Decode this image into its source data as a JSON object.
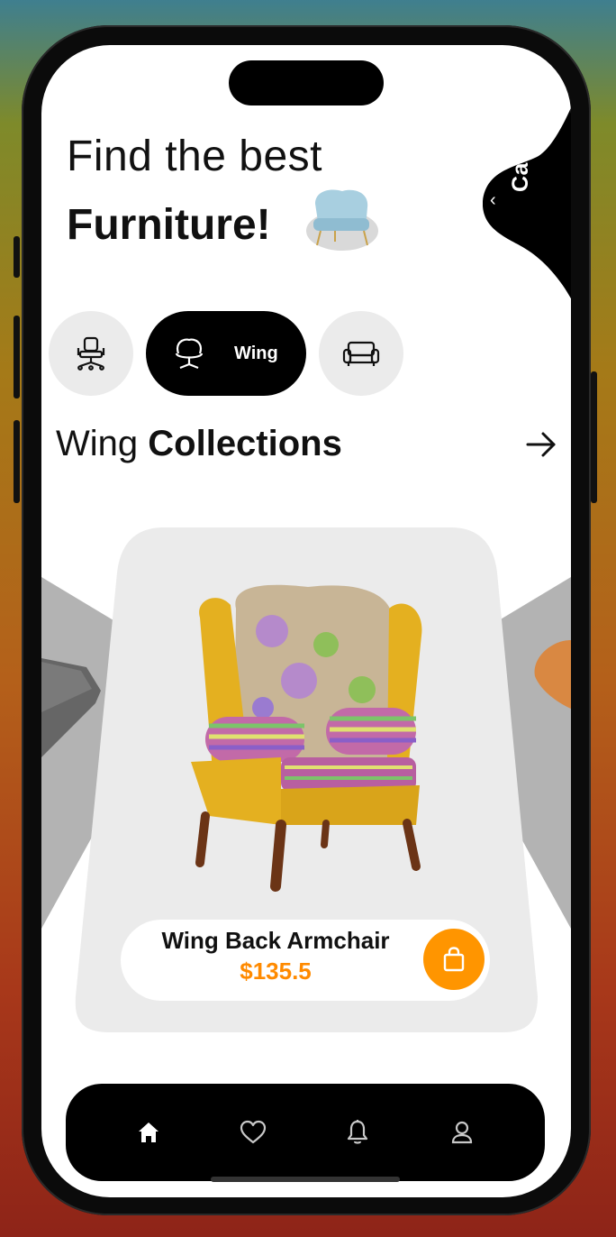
{
  "header": {
    "line1": "Find the best",
    "line2": "Furniture!"
  },
  "cart": {
    "label": "Cart"
  },
  "categories": [
    {
      "icon": "office-chair-icon",
      "label": ""
    },
    {
      "icon": "wing-chair-icon",
      "label": "Wing",
      "active": true
    },
    {
      "icon": "sofa-icon",
      "label": ""
    }
  ],
  "section": {
    "title_light": "Wing",
    "title_bold": "Collections"
  },
  "product": {
    "name": "Wing Back Armchair",
    "price": "$135.5"
  },
  "nav": [
    "home-icon",
    "heart-icon",
    "bell-icon",
    "profile-icon"
  ],
  "colors": {
    "accent": "#ff9500",
    "price": "#ff8a00",
    "dark": "#000000",
    "card_bg": "#ebebeb"
  }
}
